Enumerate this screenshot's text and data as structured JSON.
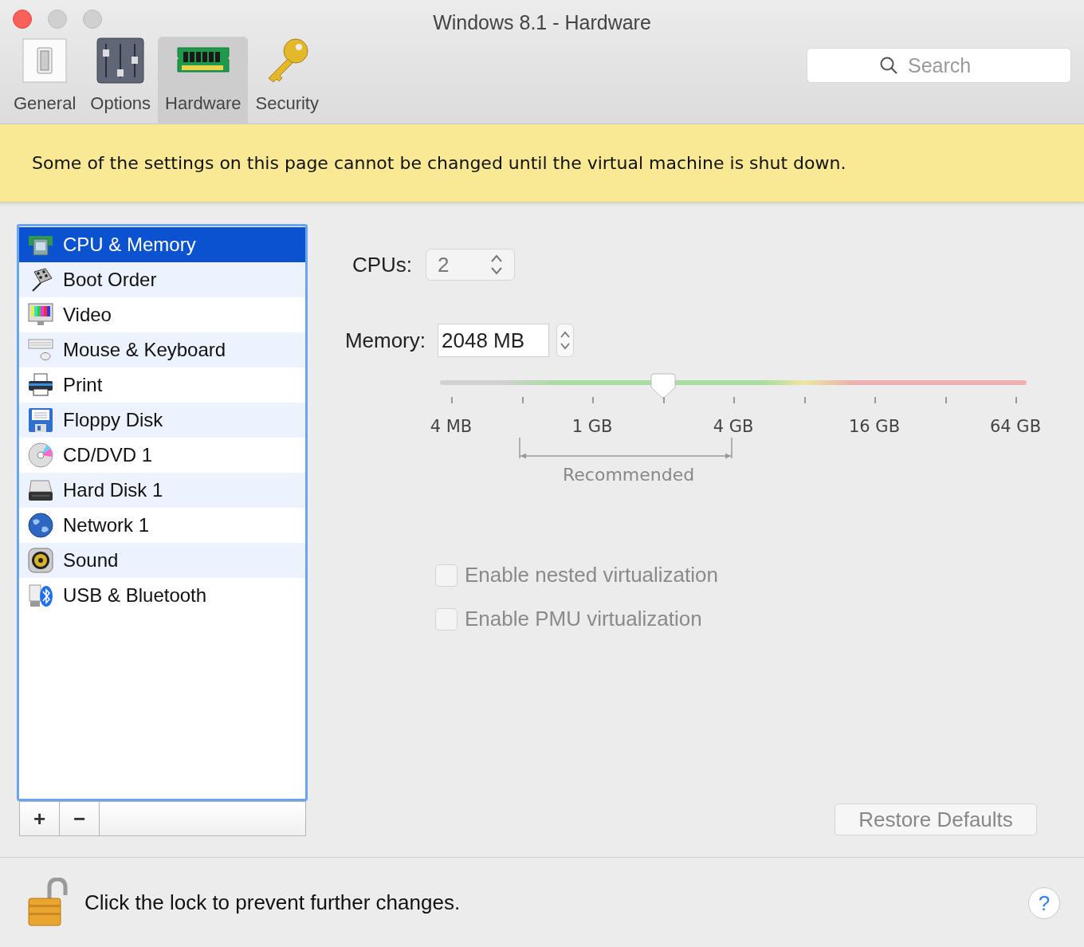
{
  "window": {
    "title": "Windows 8.1 - Hardware"
  },
  "toolbar": {
    "tabs": [
      {
        "label": "General",
        "selected": false
      },
      {
        "label": "Options",
        "selected": false
      },
      {
        "label": "Hardware",
        "selected": true
      },
      {
        "label": "Security",
        "selected": false
      }
    ],
    "search": {
      "placeholder": "Search"
    }
  },
  "banner": "Some of the settings on this page cannot be changed until the virtual machine is shut down.",
  "sidebar": {
    "items": [
      {
        "label": "CPU & Memory",
        "selected": true
      },
      {
        "label": "Boot Order",
        "selected": false
      },
      {
        "label": "Video",
        "selected": false
      },
      {
        "label": "Mouse & Keyboard",
        "selected": false
      },
      {
        "label": "Print",
        "selected": false
      },
      {
        "label": "Floppy Disk",
        "selected": false
      },
      {
        "label": "CD/DVD 1",
        "selected": false
      },
      {
        "label": "Hard Disk 1",
        "selected": false
      },
      {
        "label": "Network 1",
        "selected": false
      },
      {
        "label": "Sound",
        "selected": false
      },
      {
        "label": "USB & Bluetooth",
        "selected": false
      }
    ],
    "buttons": [
      "+",
      "−"
    ]
  },
  "cpus": {
    "label": "CPUs:",
    "value": "2"
  },
  "memory": {
    "label": "Memory:",
    "value": "2048 MB",
    "level": 0.38,
    "scale": [
      "4 MB",
      "1 GB",
      "4 GB",
      "16 GB",
      "64 GB"
    ],
    "recommended": "Recommended"
  },
  "options": [
    {
      "label": "Enable nested virtualization",
      "checked": false,
      "disabled": true
    },
    {
      "label": "Enable PMU virtualization",
      "checked": false,
      "disabled": true
    }
  ],
  "restore_button": "Restore Defaults",
  "footer": {
    "text": "Click the lock to prevent further changes.",
    "help": "?"
  }
}
